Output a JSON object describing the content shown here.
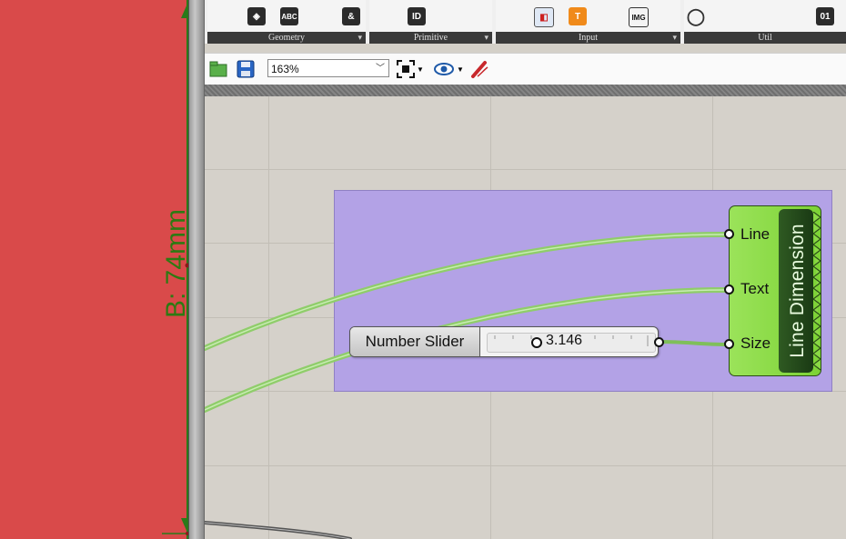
{
  "viewport": {
    "dimension_label": "B: 74mm"
  },
  "ribbon": {
    "panels": [
      {
        "name": "Geometry"
      },
      {
        "name": "Primitive"
      },
      {
        "name": "Input"
      },
      {
        "name": "Util"
      }
    ]
  },
  "toolbar": {
    "zoom": "163%"
  },
  "canvas": {
    "slider": {
      "label": "Number Slider",
      "value": "3.146"
    },
    "component": {
      "title": "Line Dimension",
      "inputs": [
        "Line",
        "Text",
        "Size"
      ]
    }
  },
  "colors": {
    "viewport_bg": "#d94a4a",
    "dimension": "#2d7a12",
    "group_fill": "#b3a2e6",
    "component": "#8ad845",
    "wire": "#8fcd6a",
    "canvas": "#d5d1ca"
  }
}
